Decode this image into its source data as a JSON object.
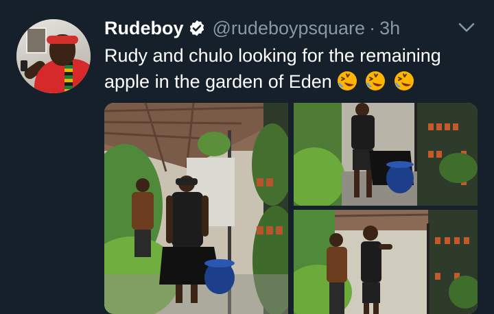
{
  "tweet": {
    "author": {
      "name": "Rudeboy",
      "handle": "@rudeboypsquare",
      "verified": true
    },
    "separator": "·",
    "time": "3h",
    "text": "Rudy and chulo looking for the remaining apple in the garden of Eden",
    "emojis": [
      "rolling-on-floor-laughing-emoji",
      "rolling-on-floor-laughing-emoji",
      "rolling-on-floor-laughing-emoji"
    ],
    "media_count": 3
  },
  "colors": {
    "background": "#15202b",
    "primary_text": "#ffffff",
    "secondary_text": "#8899a6",
    "verified_badge": "#ffffff"
  },
  "icons": {
    "verified": "verified-badge-icon",
    "menu": "chevron-down-icon"
  }
}
